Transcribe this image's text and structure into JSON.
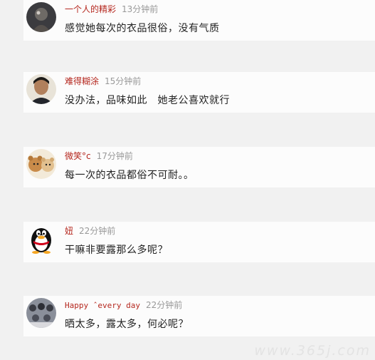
{
  "comments": [
    {
      "username": "一个人的精彩",
      "time": "13分钟前",
      "text": "感觉她每次的衣品很俗，没有气质",
      "avatar_icon": "dark-photo-avatar-icon"
    },
    {
      "username": "难得糊涂",
      "time": "15分钟前",
      "text": "没办法，品味如此　她老公喜欢就行",
      "avatar_icon": "man-portrait-avatar-icon"
    },
    {
      "username": "微笑°c",
      "time": "17分钟前",
      "text": "每一次的衣品都俗不可耐。。",
      "avatar_icon": "teddy-bears-avatar-icon"
    },
    {
      "username": "妞",
      "time": "22分钟前",
      "text": "干嘛非要露那么多呢？",
      "avatar_icon": "qq-penguin-avatar-icon"
    },
    {
      "username": "Happy ˆevery day",
      "time": "22分钟前",
      "text": "晒太多，露太多，何必呢？",
      "avatar_icon": "group-photo-avatar-icon"
    }
  ],
  "watermark": "www.365j.com",
  "colors": {
    "background": "#f1f1f1",
    "card": "#fcfcfc",
    "username": "#b5271e",
    "time": "#999999",
    "text": "#222222"
  }
}
